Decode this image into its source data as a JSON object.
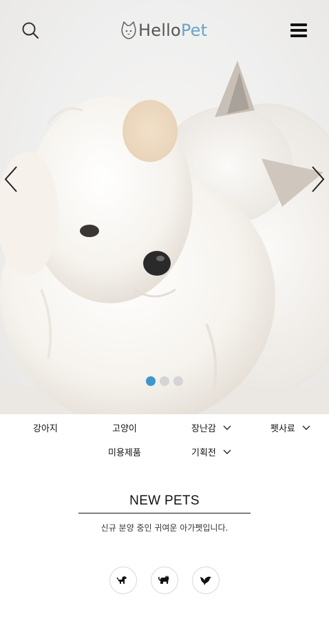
{
  "header": {
    "brand_part1": "Hello",
    "brand_part2": "Pet",
    "search_icon": "search-icon",
    "menu_icon": "hamburger-menu-icon",
    "logo_icon": "cat-face-icon",
    "brand_color": "#6aa3c6"
  },
  "carousel": {
    "image": "puppy-and-kitten-photo",
    "prev_icon": "chevron-left-icon",
    "next_icon": "chevron-right-icon",
    "slide_count": 3,
    "active_slide": 1,
    "active_dot_color": "#3c97cd"
  },
  "categories": [
    {
      "label": "강아지",
      "has_dropdown": false
    },
    {
      "label": "고양이",
      "has_dropdown": false
    },
    {
      "label": "장난감",
      "has_dropdown": true
    },
    {
      "label": "펫사료",
      "has_dropdown": true
    },
    {
      "label": "미용제품",
      "has_dropdown": false
    },
    {
      "label": "기획전",
      "has_dropdown": true
    }
  ],
  "new_pets": {
    "title": "NEW PETS",
    "subtitle": "신규 분양 중인 귀여운 아가펫입니다.",
    "icons": [
      "dog-icon",
      "cat-icon",
      "bird-icon"
    ]
  }
}
